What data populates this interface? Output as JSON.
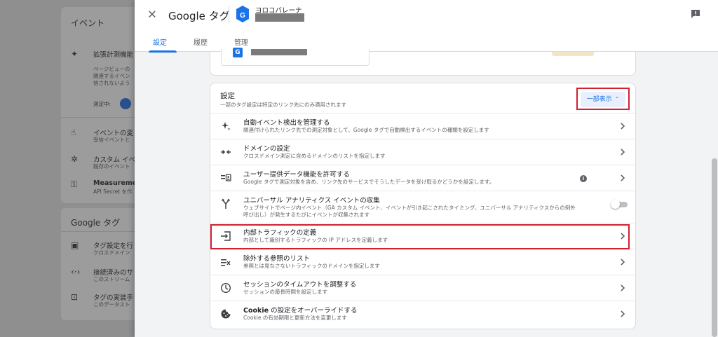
{
  "background": {
    "events_title": "イベント",
    "event_items": [
      {
        "label": "拡張計測機能",
        "sub": ""
      },
      {
        "label": "イベントの変",
        "sub": "受信イベントと"
      },
      {
        "label": "カスタム イベ",
        "sub": "既存のイベント"
      },
      {
        "label": "Measurement",
        "sub": "API Secret を作"
      }
    ],
    "enhanced_desc": [
      "ページビューの",
      "関連するイベン",
      "信されないよう"
    ],
    "measuring_label": "測定中:",
    "google_tag_title": "Google タグ",
    "tag_items": [
      {
        "label": "タグ設定を行",
        "sub": "クロスドメイン"
      },
      {
        "label": "接続済みのサ",
        "sub": "このストリーム"
      },
      {
        "label": "タグの実装手",
        "sub": "このデータスト"
      }
    ]
  },
  "header": {
    "title": "Google タグ",
    "account_name": "ヨロコバレーナ"
  },
  "tabs": [
    {
      "label": "設定",
      "active": true
    },
    {
      "label": "履歴",
      "active": false
    },
    {
      "label": "管理",
      "active": false
    }
  ],
  "settings": {
    "title": "設定",
    "subtitle": "一部のタグ設定は特定のリンク先にのみ適用されます",
    "partial_button": "一部表示",
    "rows": [
      {
        "title": "自動イベント検出を管理する",
        "desc": "関連付けられたリンク先での測定対象として、Google タグで自動検出するイベントの種類を設定します",
        "icon": "sparkle-icon"
      },
      {
        "title": "ドメインの設定",
        "desc": "クロスドメイン測定に含めるドメインのリストを指定します",
        "icon": "merge-arrows-icon"
      },
      {
        "title": "ユーザー提供データ機能を許可する",
        "desc": "Google タグで測定対象を含め、リンク先のサービスでそうしたデータを受け取るかどうかを設定します。",
        "icon": "user-data-icon"
      },
      {
        "title": "ユニバーサル アナリティクス イベントの収集",
        "desc": "ウェブサイトでページ内イベント（GA カスタム イベント、イベントが引き起こされたタイミング、ユニバーサル アナリティクスからの例外",
        "desc2": "呼び出し）が発生するたびにイベントが収集されます",
        "icon": "fork-icon"
      },
      {
        "title": "内部トラフィックの定義",
        "desc": "内部として識別するトラフィックの IP アドレスを定義します",
        "icon": "login-icon"
      },
      {
        "title": "除外する参照のリスト",
        "desc": "参照とは見なさないトラフィックのドメインを指定します",
        "icon": "exclude-list-icon"
      },
      {
        "title": "セッションのタイムアウトを調整する",
        "desc": "セッションの最長時間を設定します",
        "icon": "clock-icon"
      },
      {
        "title_bold": "Cookie",
        "title": " の設定をオーバーライドする",
        "desc": "Cookie の有効期限と更新方法を変更します",
        "icon": "cookie-icon"
      }
    ]
  }
}
